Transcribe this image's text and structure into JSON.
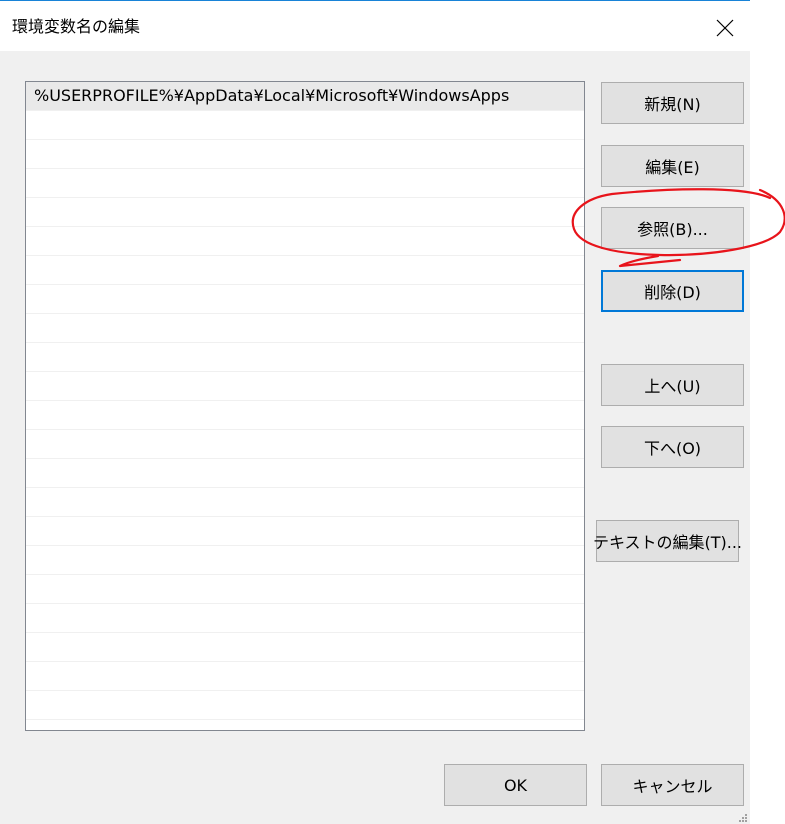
{
  "window": {
    "title": "環境変数名の編集",
    "close_icon": "close-icon"
  },
  "list": {
    "items": [
      "%USERPROFILE%¥AppData¥Local¥Microsoft¥WindowsApps"
    ],
    "selected_index": 0,
    "empty_rows": 21
  },
  "buttons": {
    "new": "新規(N)",
    "edit": "編集(E)",
    "browse": "参照(B)...",
    "delete": "削除(D)",
    "up": "上へ(U)",
    "down": "下へ(O)",
    "edit_text": "テキストの編集(T)...",
    "ok": "OK",
    "cancel": "キャンセル"
  },
  "annotation": {
    "color": "#e8141b",
    "shape": "hand-drawn circle around browse button"
  },
  "colors": {
    "dialog_bg": "#f0f0f0",
    "focus_border": "#0078d7",
    "button_bg": "#e1e1e1"
  }
}
